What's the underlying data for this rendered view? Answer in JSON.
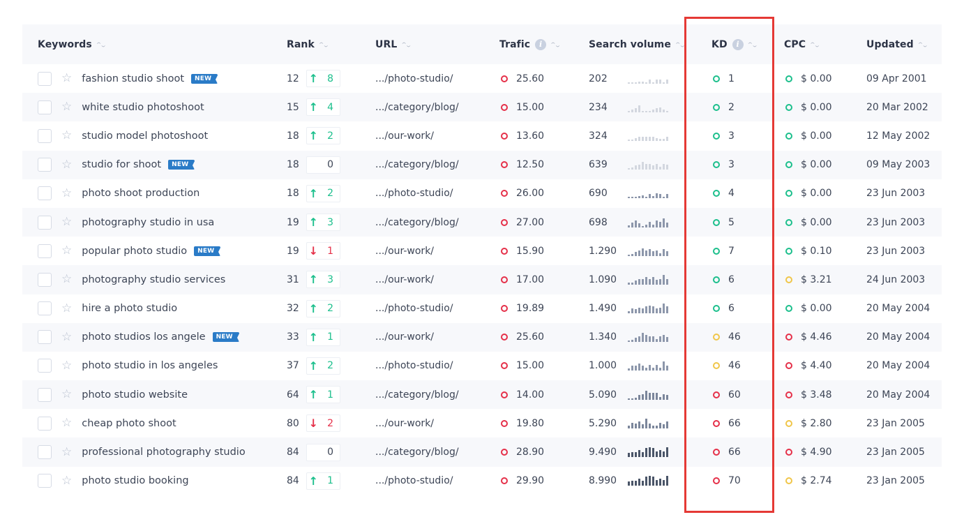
{
  "colors": {
    "green": "#1cbf8c",
    "yellow": "#f0c649",
    "red": "#e53049",
    "badge_blue": "#2a7bc7",
    "highlight": "#e53935"
  },
  "header": {
    "keywords": "Keywords",
    "rank": "Rank",
    "url": "URL",
    "traffic": "Trafic",
    "search_volume": "Search volume",
    "kd": "KD",
    "cpc": "CPC",
    "updated": "Updated",
    "sort_icon": "sort-arrows-icon",
    "info_icon": "i"
  },
  "rows": [
    {
      "keyword": "fashion studio shoot",
      "new": true,
      "badge": "NEW",
      "rank": "12",
      "change": "8",
      "dir": "up",
      "url": ".../photo-studio/",
      "traffic": "25.60",
      "traffic_level": "red",
      "volume": "202",
      "trend": [
        0.1,
        0.1,
        0.1,
        0.2,
        0.2,
        0.1,
        0.4,
        0.1,
        0.4,
        0.4,
        0.1,
        0.4
      ],
      "kd": "1",
      "kd_level": "green",
      "cpc": "$ 0.00",
      "cpc_level": "green",
      "updated": "09 Apr 2001"
    },
    {
      "keyword": "white studio photoshoot",
      "new": false,
      "rank": "15",
      "change": "4",
      "dir": "up",
      "url": ".../category/blog/",
      "traffic": "15.00",
      "traffic_level": "red",
      "volume": "234",
      "trend": [
        0.1,
        0.3,
        0.4,
        0.7,
        0.1,
        0.1,
        0.1,
        0.3,
        0.4,
        0.5,
        0.3,
        0.1
      ],
      "kd": "2",
      "kd_level": "green",
      "cpc": "$ 0.00",
      "cpc_level": "green",
      "updated": "20 Mar 2002"
    },
    {
      "keyword": "studio model photoshoot",
      "new": false,
      "rank": "18",
      "change": "2",
      "dir": "up",
      "url": ".../our-work/",
      "traffic": "13.60",
      "traffic_level": "red",
      "volume": "324",
      "trend": [
        0.1,
        0.1,
        0.3,
        0.4,
        0.4,
        0.4,
        0.4,
        0.4,
        0.3,
        0.2,
        0.2,
        0.4
      ],
      "kd": "3",
      "kd_level": "green",
      "cpc": "$ 0.00",
      "cpc_level": "green",
      "updated": "12 May 2002"
    },
    {
      "keyword": "studio for shoot",
      "new": true,
      "badge": "NEW",
      "rank": "18",
      "change": "0",
      "dir": "flat",
      "url": ".../category/blog/",
      "traffic": "12.50",
      "traffic_level": "red",
      "volume": "639",
      "trend": [
        0.1,
        0.2,
        0.4,
        0.5,
        0.8,
        0.6,
        0.6,
        0.4,
        0.6,
        0.3,
        0.6,
        0.5
      ],
      "kd": "3",
      "kd_level": "green",
      "cpc": "$ 0.00",
      "cpc_level": "green",
      "updated": "09 May 2003"
    },
    {
      "keyword": "photo shoot production",
      "new": false,
      "rank": "18",
      "change": "2",
      "dir": "up",
      "url": ".../photo-studio/",
      "traffic": "26.00",
      "traffic_level": "red",
      "volume": "690",
      "trend": [
        0.1,
        0.1,
        0.1,
        0.2,
        0.3,
        0.1,
        0.4,
        0.2,
        0.5,
        0.4,
        0.1,
        0.4
      ],
      "kd": "4",
      "kd_level": "green",
      "cpc": "$ 0.00",
      "cpc_level": "green",
      "updated": "23 Jun 2003"
    },
    {
      "keyword": "photography studio in usa",
      "new": false,
      "rank": "19",
      "change": "3",
      "dir": "up",
      "url": ".../category/blog/",
      "traffic": "27.00",
      "traffic_level": "red",
      "volume": "698",
      "trend": [
        0.2,
        0.5,
        0.7,
        0.4,
        0.1,
        0.3,
        0.6,
        0.3,
        0.7,
        0.6,
        0.9,
        0.5
      ],
      "kd": "5",
      "kd_level": "green",
      "cpc": "$ 0.00",
      "cpc_level": "green",
      "updated": "23 Jun 2003"
    },
    {
      "keyword": "popular photo studio",
      "new": true,
      "badge": "NEW",
      "rank": "19",
      "change": "1",
      "dir": "down",
      "url": ".../our-work/",
      "traffic": "15.90",
      "traffic_level": "red",
      "volume": "1.290",
      "trend": [
        0.1,
        0.2,
        0.4,
        0.6,
        0.8,
        0.6,
        0.7,
        0.5,
        0.6,
        0.3,
        0.7,
        0.5
      ],
      "kd": "7",
      "kd_level": "green",
      "cpc": "$ 0.10",
      "cpc_level": "green",
      "updated": "23 Jun 2003"
    },
    {
      "keyword": "photography studio services",
      "new": false,
      "rank": "31",
      "change": "3",
      "dir": "up",
      "url": ".../our-work/",
      "traffic": "17.00",
      "traffic_level": "red",
      "volume": "1.090",
      "trend": [
        0.2,
        0.2,
        0.4,
        0.6,
        0.6,
        0.8,
        0.6,
        0.8,
        0.5,
        0.6,
        1.0,
        0.6
      ],
      "kd": "6",
      "kd_level": "green",
      "cpc": "$ 3.21",
      "cpc_level": "yellow",
      "updated": "24 Jun 2003"
    },
    {
      "keyword": "hire a photo studio",
      "new": false,
      "rank": "32",
      "change": "2",
      "dir": "up",
      "url": ".../photo-studio/",
      "traffic": "19.89",
      "traffic_level": "red",
      "volume": "1.490",
      "trend": [
        0.2,
        0.5,
        0.4,
        0.6,
        0.5,
        0.7,
        0.8,
        0.7,
        0.5,
        0.6,
        1.0,
        0.7
      ],
      "kd": "6",
      "kd_level": "green",
      "cpc": "$ 0.00",
      "cpc_level": "green",
      "updated": "20 May 2004"
    },
    {
      "keyword": "photo studios los angele",
      "new": true,
      "badge": "NEW",
      "rank": "33",
      "change": "1",
      "dir": "up",
      "url": ".../our-work/",
      "traffic": "25.60",
      "traffic_level": "red",
      "volume": "1.340",
      "trend": [
        0.1,
        0.2,
        0.4,
        0.6,
        0.9,
        0.7,
        0.6,
        0.6,
        0.3,
        0.6,
        0.7,
        0.5
      ],
      "kd": "46",
      "kd_level": "yellow",
      "cpc": "$ 4.46",
      "cpc_level": "red",
      "updated": "20 May 2004"
    },
    {
      "keyword": "photo studio in los angeles",
      "new": false,
      "rank": "37",
      "change": "2",
      "dir": "up",
      "url": ".../photo-studio/",
      "traffic": "15.00",
      "traffic_level": "red",
      "volume": "1.000",
      "trend": [
        0.2,
        0.5,
        0.5,
        0.7,
        0.5,
        0.3,
        0.6,
        0.3,
        0.6,
        0.3,
        0.9,
        0.5
      ],
      "kd": "46",
      "kd_level": "yellow",
      "cpc": "$ 4.40",
      "cpc_level": "red",
      "updated": "20 May 2004"
    },
    {
      "keyword": "photo studio website",
      "new": false,
      "rank": "64",
      "change": "1",
      "dir": "up",
      "url": ".../category/blog/",
      "traffic": "14.00",
      "traffic_level": "red",
      "volume": "5.090",
      "trend": [
        0.1,
        0.1,
        0.2,
        0.5,
        0.6,
        0.9,
        0.7,
        0.7,
        0.7,
        0.3,
        0.6,
        0.5
      ],
      "kd": "60",
      "kd_level": "red",
      "cpc": "$ 3.48",
      "cpc_level": "red",
      "updated": "20 May 2004"
    },
    {
      "keyword": "cheap photo shoot",
      "new": false,
      "rank": "80",
      "change": "2",
      "dir": "down",
      "url": ".../our-work/",
      "traffic": "19.80",
      "traffic_level": "red",
      "volume": "5.290",
      "trend": [
        0.3,
        0.6,
        0.5,
        0.7,
        0.4,
        1.0,
        0.5,
        0.3,
        0.3,
        0.6,
        0.4,
        0.7
      ],
      "kd": "66",
      "kd_level": "red",
      "cpc": "$ 2.80",
      "cpc_level": "yellow",
      "updated": "23 Jan 2005"
    },
    {
      "keyword": "professional photography studio",
      "new": false,
      "rank": "84",
      "change": "0",
      "dir": "flat",
      "url": ".../category/blog/",
      "traffic": "28.90",
      "traffic_level": "red",
      "volume": "9.490",
      "trend": [
        0.4,
        0.5,
        0.5,
        0.7,
        0.5,
        0.9,
        1.0,
        0.9,
        0.6,
        0.7,
        0.6,
        1.0
      ],
      "kd": "66",
      "kd_level": "red",
      "cpc": "$ 4.90",
      "cpc_level": "red",
      "updated": "23 Jan 2005"
    },
    {
      "keyword": "photo studio booking",
      "new": false,
      "rank": "84",
      "change": "1",
      "dir": "up",
      "url": ".../photo-studio/",
      "traffic": "29.90",
      "traffic_level": "red",
      "volume": "8.990",
      "trend": [
        0.4,
        0.5,
        0.5,
        0.7,
        0.5,
        0.9,
        1.0,
        0.9,
        0.6,
        0.7,
        0.6,
        1.0
      ],
      "kd": "70",
      "kd_level": "red",
      "cpc": "$ 2.74",
      "cpc_level": "yellow",
      "updated": "23 Jan 2005"
    }
  ],
  "highlighted_column": "KD"
}
